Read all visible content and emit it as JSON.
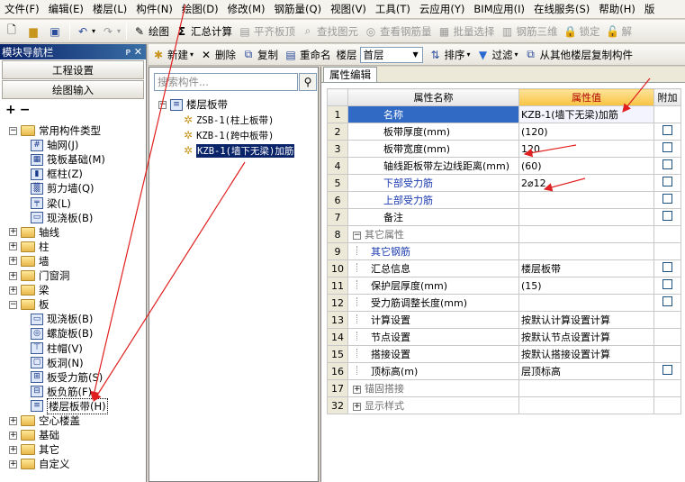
{
  "menubar": [
    "文件(F)",
    "编辑(E)",
    "楼层(L)",
    "构件(N)",
    "绘图(D)",
    "修改(M)",
    "钢筋量(Q)",
    "视图(V)",
    "工具(T)",
    "云应用(Y)",
    "BIM应用(I)",
    "在线服务(S)",
    "帮助(H)",
    "版"
  ],
  "toolbar": {
    "draw": "绘图",
    "summary": "汇总计算",
    "flat_top": "平齐板顶",
    "find_elem": "查找图元",
    "view_rebar": "查看钢筋量",
    "batch_select": "批量选择",
    "rebar_3d": "钢筋三维",
    "lock": "锁定",
    "unlock": "解"
  },
  "nav": {
    "title": "模块导航栏",
    "pin": "ᴘ x",
    "btn_project": "工程设置",
    "btn_draw": "绘图输入",
    "tree": [
      {
        "label": "常用构件类型",
        "type": "folder",
        "expanded": true,
        "depth": 0
      },
      {
        "label": "轴网(J)",
        "type": "leaf",
        "depth": 1,
        "icon": "grid"
      },
      {
        "label": "筏板基础(M)",
        "type": "leaf",
        "depth": 1,
        "icon": "raft"
      },
      {
        "label": "框柱(Z)",
        "type": "leaf",
        "depth": 1,
        "icon": "column"
      },
      {
        "label": "剪力墙(Q)",
        "type": "leaf",
        "depth": 1,
        "icon": "wall"
      },
      {
        "label": "梁(L)",
        "type": "leaf",
        "depth": 1,
        "icon": "beam"
      },
      {
        "label": "现浇板(B)",
        "type": "leaf",
        "depth": 1,
        "icon": "slab"
      },
      {
        "label": "轴线",
        "type": "folder",
        "expanded": false,
        "depth": 0
      },
      {
        "label": "柱",
        "type": "folder",
        "expanded": false,
        "depth": 0
      },
      {
        "label": "墙",
        "type": "folder",
        "expanded": false,
        "depth": 0
      },
      {
        "label": "门窗洞",
        "type": "folder",
        "expanded": false,
        "depth": 0
      },
      {
        "label": "梁",
        "type": "folder",
        "expanded": false,
        "depth": 0
      },
      {
        "label": "板",
        "type": "folder",
        "expanded": true,
        "depth": 0
      },
      {
        "label": "现浇板(B)",
        "type": "leaf",
        "depth": 1,
        "icon": "slab"
      },
      {
        "label": "螺旋板(B)",
        "type": "leaf",
        "depth": 1,
        "icon": "spiral"
      },
      {
        "label": "柱帽(V)",
        "type": "leaf",
        "depth": 1,
        "icon": "cap"
      },
      {
        "label": "板洞(N)",
        "type": "leaf",
        "depth": 1,
        "icon": "hole"
      },
      {
        "label": "板受力筋(S)",
        "type": "leaf",
        "depth": 1,
        "icon": "rebar"
      },
      {
        "label": "板负筋(F)",
        "type": "leaf",
        "depth": 1,
        "icon": "negrebar"
      },
      {
        "label": "楼层板带(H)",
        "type": "leaf",
        "depth": 1,
        "icon": "strip",
        "selected": true
      },
      {
        "label": "空心楼盖",
        "type": "folder",
        "expanded": false,
        "depth": 0
      },
      {
        "label": "基础",
        "type": "folder",
        "expanded": false,
        "depth": 0
      },
      {
        "label": "其它",
        "type": "folder",
        "expanded": false,
        "depth": 0
      },
      {
        "label": "自定义",
        "type": "folder",
        "expanded": false,
        "depth": 0
      }
    ]
  },
  "midtb": {
    "new": "新建",
    "delete": "删除",
    "copy": "复制",
    "rename": "重命名",
    "floor_label": "楼层",
    "floor_value": "首层",
    "sort": "排序",
    "filter": "过滤",
    "copy_from": "从其他楼层复制构件"
  },
  "elements": {
    "search_placeholder": "搜索构件...",
    "root": "楼层板带",
    "items": [
      {
        "label": "ZSB-1(柱上板带)"
      },
      {
        "label": "KZB-1(跨中板带)"
      },
      {
        "label": "KZB-1(墙下无梁)加筋",
        "selected": true
      }
    ]
  },
  "props": {
    "tab": "属性编辑",
    "headers": {
      "name": "属性名称",
      "value": "属性值",
      "extra": "附加"
    },
    "rows": [
      {
        "n": "1",
        "name": "名称",
        "value": "KZB-1(墙下无梁)加筋",
        "cb": false,
        "blue": false,
        "sel": true
      },
      {
        "n": "2",
        "name": "板带厚度(mm)",
        "value": "(120)",
        "cb": true
      },
      {
        "n": "3",
        "name": "板带宽度(mm)",
        "value": "120",
        "cb": true
      },
      {
        "n": "4",
        "name": "轴线距板带左边线距离(mm)",
        "value": "(60)",
        "cb": true
      },
      {
        "n": "5",
        "name": "下部受力筋",
        "value": "2⌀12",
        "cb": true,
        "blue": true
      },
      {
        "n": "6",
        "name": "上部受力筋",
        "value": "",
        "cb": true,
        "blue": true
      },
      {
        "n": "7",
        "name": "备注",
        "value": "",
        "cb": true
      },
      {
        "n": "8",
        "name": "其它属性",
        "value": "",
        "cb": false,
        "group": "−",
        "gray": true
      },
      {
        "n": "9",
        "name": "其它钢筋",
        "value": "",
        "cb": false,
        "blue": true,
        "indent": true
      },
      {
        "n": "10",
        "name": "汇总信息",
        "value": "楼层板带",
        "cb": true,
        "indent": true
      },
      {
        "n": "11",
        "name": "保护层厚度(mm)",
        "value": "(15)",
        "cb": true,
        "indent": true
      },
      {
        "n": "12",
        "name": "受力筋调整长度(mm)",
        "value": "",
        "cb": true,
        "indent": true
      },
      {
        "n": "13",
        "name": "计算设置",
        "value": "按默认计算设置计算",
        "cb": false,
        "indent": true
      },
      {
        "n": "14",
        "name": "节点设置",
        "value": "按默认节点设置计算",
        "cb": false,
        "indent": true
      },
      {
        "n": "15",
        "name": "搭接设置",
        "value": "按默认搭接设置计算",
        "cb": false,
        "indent": true
      },
      {
        "n": "16",
        "name": "顶标高(m)",
        "value": "层顶标高",
        "cb": true,
        "indent": true
      },
      {
        "n": "17",
        "name": "锚固搭接",
        "value": "",
        "cb": false,
        "group": "+",
        "gray": true
      },
      {
        "n": "32",
        "name": "显示样式",
        "value": "",
        "cb": false,
        "group": "+",
        "gray": true
      }
    ]
  },
  "colors": {
    "annotation_red": "#e02020",
    "selection": "#0a246a",
    "value_header": "#f8c240"
  }
}
